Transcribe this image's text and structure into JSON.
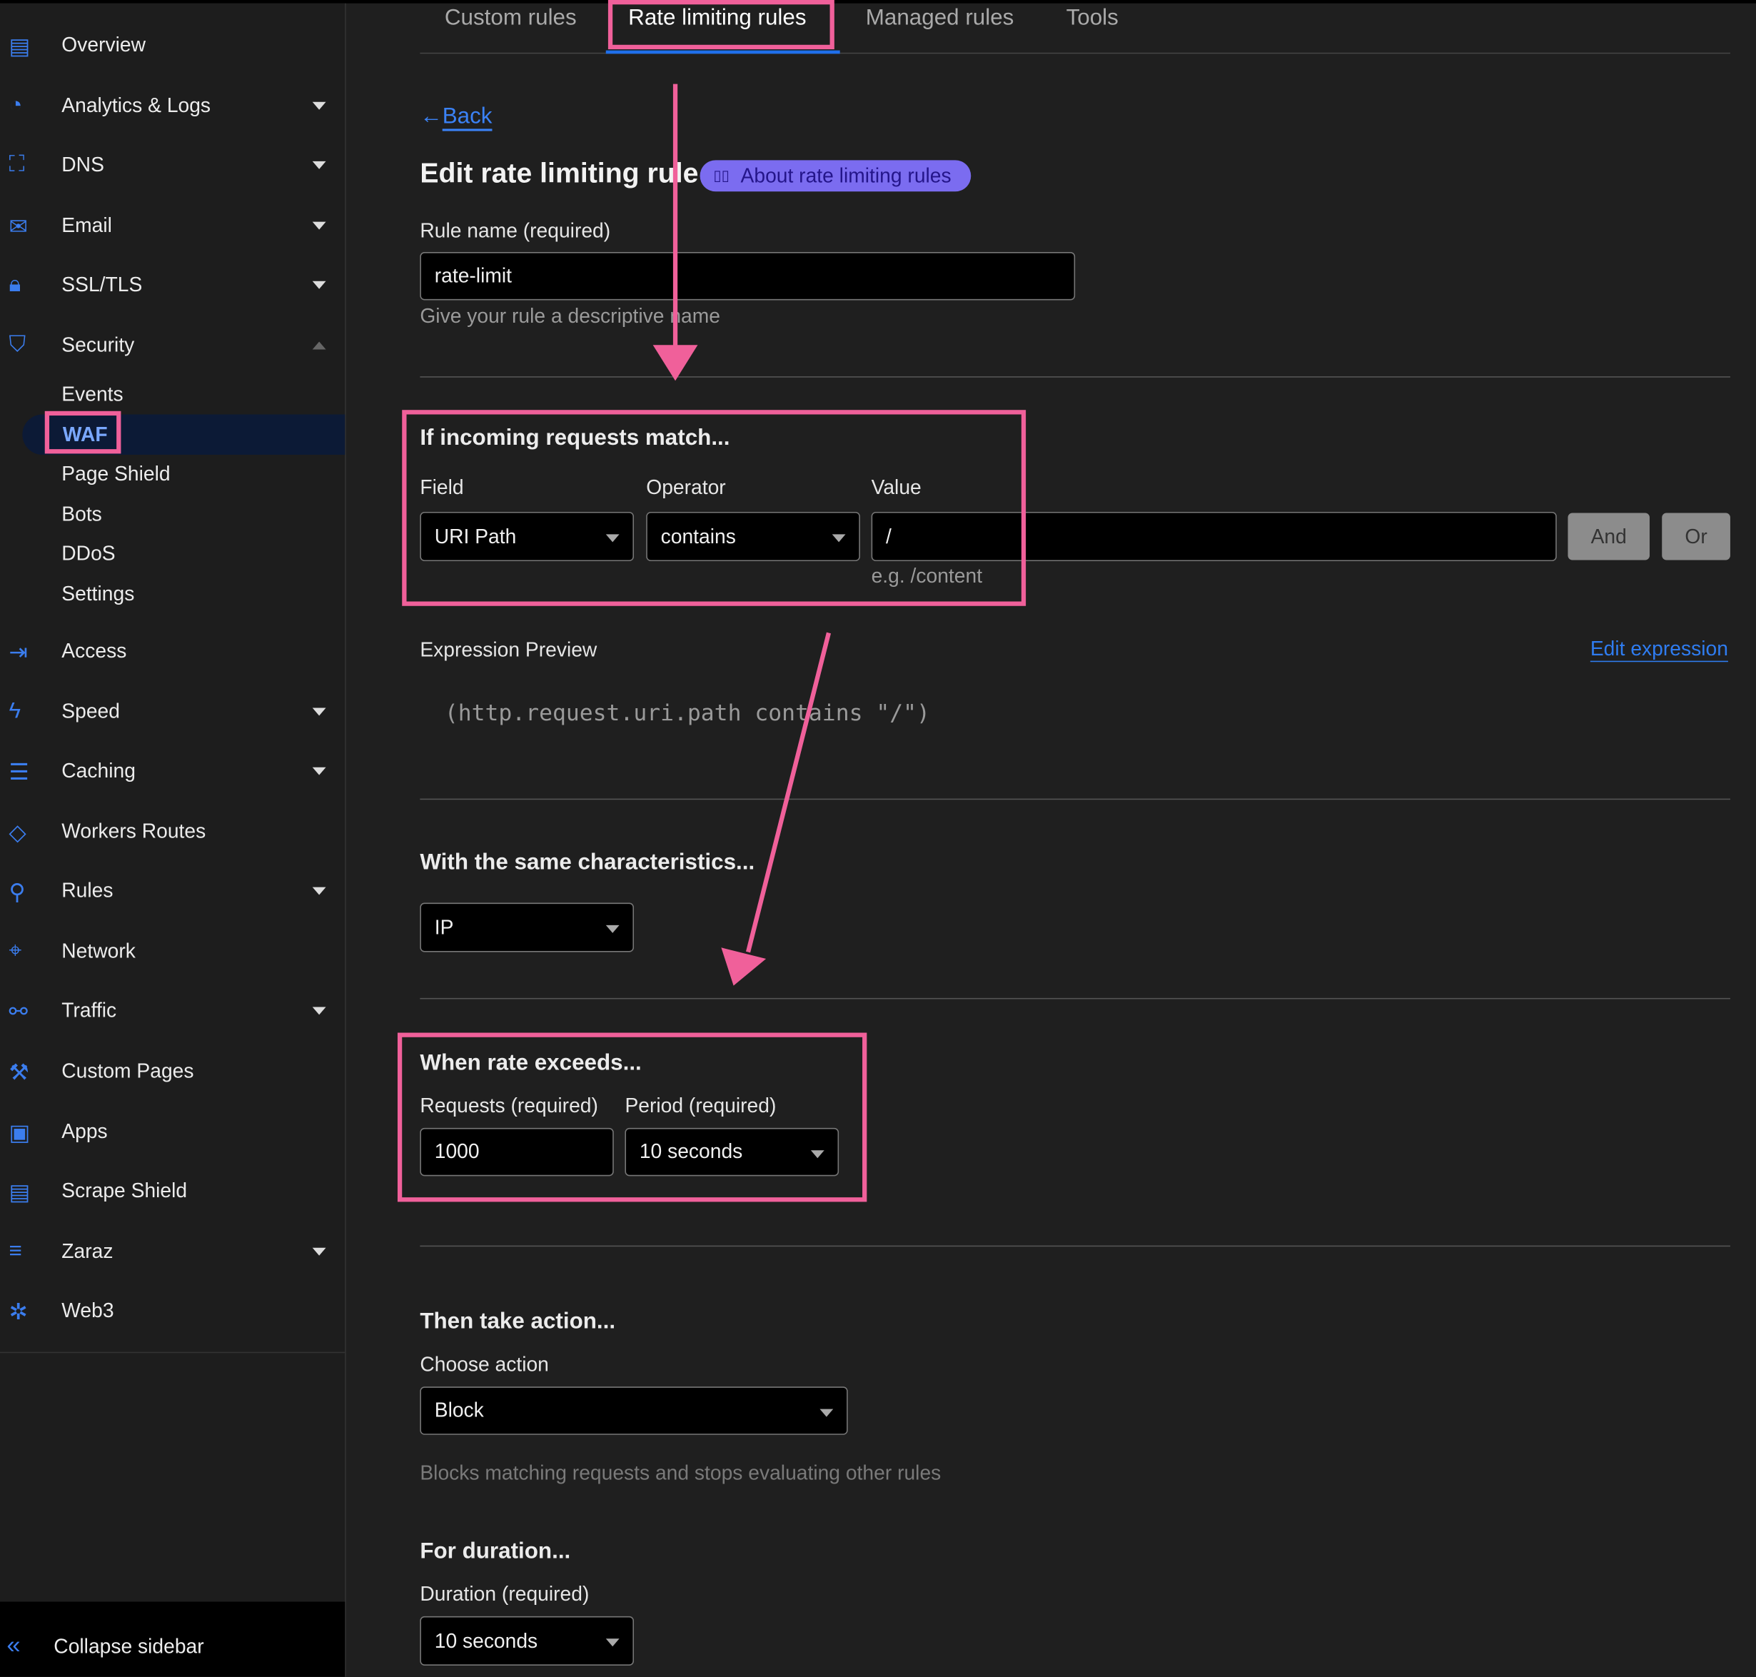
{
  "sidebar": {
    "items": [
      {
        "label": "Overview",
        "icon": "clipboard-icon",
        "dropdown": false
      },
      {
        "label": "Analytics & Logs",
        "icon": "pie-chart-icon",
        "dropdown": true
      },
      {
        "label": "DNS",
        "icon": "network-tree-icon",
        "dropdown": true
      },
      {
        "label": "Email",
        "icon": "envelope-icon",
        "dropdown": true
      },
      {
        "label": "SSL/TLS",
        "icon": "lock-icon",
        "dropdown": true
      },
      {
        "label": "Security",
        "icon": "shield-icon",
        "dropdown": true,
        "expanded": true
      },
      {
        "label": "Access",
        "icon": "access-icon",
        "dropdown": false
      },
      {
        "label": "Speed",
        "icon": "lightning-icon",
        "dropdown": true
      },
      {
        "label": "Caching",
        "icon": "server-icon",
        "dropdown": true
      },
      {
        "label": "Workers Routes",
        "icon": "workers-icon",
        "dropdown": false
      },
      {
        "label": "Rules",
        "icon": "funnel-icon",
        "dropdown": true
      },
      {
        "label": "Network",
        "icon": "location-pin-icon",
        "dropdown": false
      },
      {
        "label": "Traffic",
        "icon": "traffic-icon",
        "dropdown": true
      },
      {
        "label": "Custom Pages",
        "icon": "wrench-icon",
        "dropdown": false
      },
      {
        "label": "Apps",
        "icon": "apps-icon",
        "dropdown": false
      },
      {
        "label": "Scrape Shield",
        "icon": "document-icon",
        "dropdown": false
      },
      {
        "label": "Zaraz",
        "icon": "zaraz-icon",
        "dropdown": true
      },
      {
        "label": "Web3",
        "icon": "web3-icon",
        "dropdown": false
      }
    ],
    "security_sub": [
      "Events",
      "WAF",
      "Page Shield",
      "Bots",
      "DDoS",
      "Settings"
    ],
    "active_sub": "WAF",
    "collapse_label": "Collapse sidebar"
  },
  "tabs": [
    {
      "label": "Custom rules",
      "active": false
    },
    {
      "label": "Rate limiting rules",
      "active": true
    },
    {
      "label": "Managed rules",
      "active": false
    },
    {
      "label": "Tools",
      "active": false
    }
  ],
  "back_label": "Back",
  "page_title": "Edit rate limiting rule",
  "about_link": "About rate limiting rules",
  "rule_name": {
    "label": "Rule name (required)",
    "value": "rate-limit",
    "hint": "Give your rule a descriptive name"
  },
  "match": {
    "heading": "If incoming requests match...",
    "field_label": "Field",
    "field_value": "URI Path",
    "operator_label": "Operator",
    "operator_value": "contains",
    "value_label": "Value",
    "value": "/",
    "value_hint": "e.g. /content",
    "and_label": "And",
    "or_label": "Or"
  },
  "expression": {
    "label": "Expression Preview",
    "edit_label": "Edit expression",
    "code": "(http.request.uri.path contains \"/\")"
  },
  "characteristics": {
    "heading": "With the same characteristics...",
    "value": "IP"
  },
  "rate": {
    "heading": "When rate exceeds...",
    "requests_label": "Requests (required)",
    "requests_value": "1000",
    "period_label": "Period (required)",
    "period_value": "10 seconds"
  },
  "action": {
    "heading": "Then take action...",
    "label": "Choose action",
    "value": "Block",
    "hint": "Blocks matching requests and stops evaluating other rules"
  },
  "duration": {
    "heading": "For duration...",
    "label": "Duration (required)",
    "value": "10 seconds"
  },
  "colors": {
    "annotation": "#f0609a",
    "accent": "#1f6feb",
    "pill": "#7b6cf0"
  }
}
